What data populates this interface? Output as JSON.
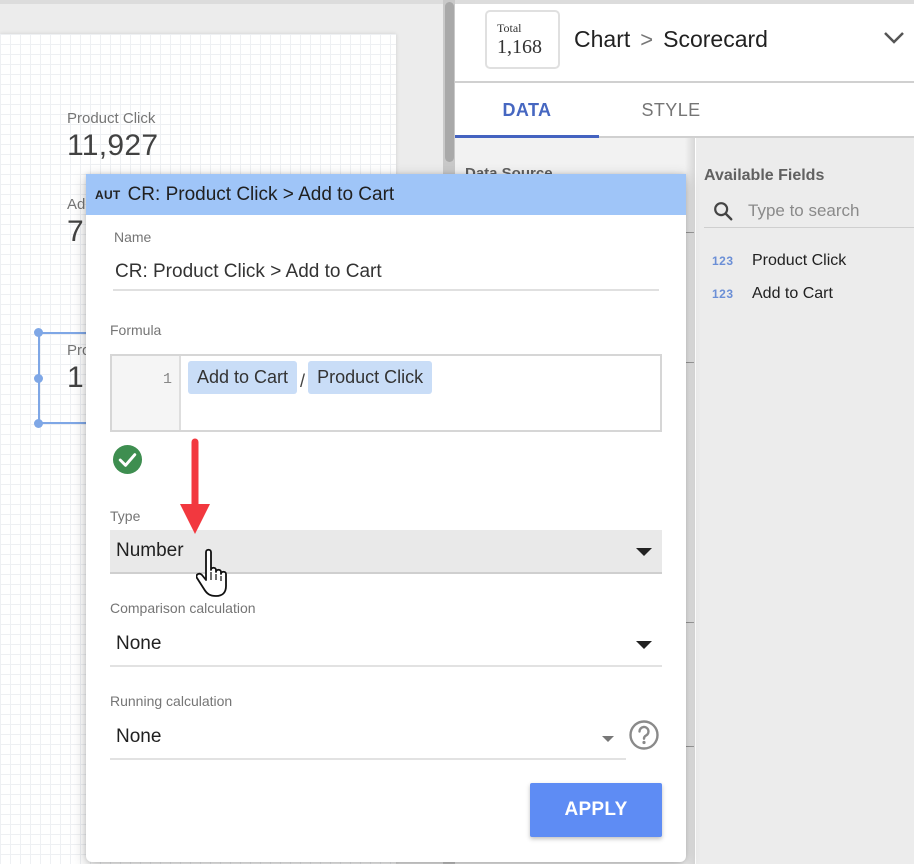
{
  "canvas": {
    "scorecards": [
      {
        "label": "Product Click",
        "value": "11,927"
      },
      {
        "label": "Ad",
        "value": "7,"
      },
      {
        "label": "Pro",
        "value": "1"
      }
    ]
  },
  "panel": {
    "chart_thumbnail": {
      "label": "Total",
      "value": "1,168"
    },
    "breadcrumb": {
      "parent": "Chart",
      "separator": ">",
      "current": "Scorecard"
    },
    "tabs": [
      {
        "label": "DATA",
        "active": true
      },
      {
        "label": "STYLE",
        "active": false
      }
    ],
    "data_source_label": "Data Source",
    "available_fields": {
      "title": "Available Fields",
      "search_placeholder": "Type to search",
      "items": [
        {
          "type_icon": "123",
          "label": "Product Click"
        },
        {
          "type_icon": "123",
          "label": "Add to Cart"
        }
      ]
    }
  },
  "editor": {
    "badge": "AUT",
    "title": "CR: Product Click > Add to Cart",
    "name_label": "Name",
    "name_value": "CR: Product Click > Add to Cart",
    "formula_label": "Formula",
    "formula": {
      "line_number": "1",
      "tokens": [
        {
          "kind": "field",
          "text": "Add to Cart"
        },
        {
          "kind": "operator",
          "text": "/"
        },
        {
          "kind": "field",
          "text": "Product Click"
        }
      ],
      "valid": true
    },
    "type_label": "Type",
    "type_value": "Number",
    "comparison_label": "Comparison calculation",
    "comparison_value": "None",
    "running_label": "Running calculation",
    "running_value": "None",
    "apply_label": "APPLY"
  },
  "colors": {
    "header_blue": "#9fc5f8",
    "chip_blue": "#c9ddf7",
    "apply_blue": "#5e8cf4",
    "tab_active": "#4667c1",
    "valid_green": "#3e8e50",
    "annotation_red": "#f2383f"
  }
}
